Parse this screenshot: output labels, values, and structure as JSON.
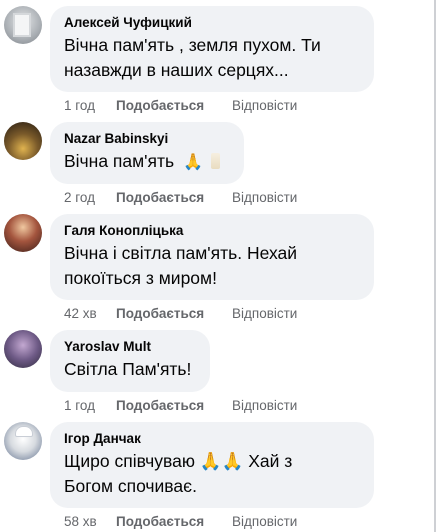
{
  "comments": [
    {
      "author": "Алексей Чуфицкий",
      "lines": [
        "Вічна пам'ять , земля пухом. Ти",
        "назавжди в наших серцях..."
      ],
      "time": "1 год",
      "like": "Подобається",
      "reply": "Відповісти",
      "avatar_colors": [
        "#cfd3d6",
        "#8d9196"
      ]
    },
    {
      "author": "Nazar Babinskyi",
      "lines": [
        "Вічна пам'ять"
      ],
      "emoji": "🙏",
      "time": "2 год",
      "like": "Подобається",
      "reply": "Відповісти",
      "avatar_colors": [
        "#3a2a1c",
        "#caa24a"
      ]
    },
    {
      "author": "Галя Коноплiцька",
      "lines": [
        "Вічна і світла пам'ять. Нехай",
        "покоїться з миром!"
      ],
      "time": "42 хв",
      "like": "Подобається",
      "reply": "Відповісти",
      "avatar_colors": [
        "#5a2a22",
        "#e7b18a"
      ]
    },
    {
      "author": "Yaroslav Mult",
      "lines": [
        "Світла Пам'ять!"
      ],
      "time": "1 год",
      "like": "Подобається",
      "reply": "Відповісти",
      "avatar_colors": [
        "#5b4a6e",
        "#b99cc7"
      ]
    },
    {
      "author": "Ігор Данчак",
      "lines": [
        "Щиро співчуваю 🙏🙏 Хай з",
        "Богом спочиває."
      ],
      "time": "58 хв",
      "like": "Подобається",
      "reply": "Відповісти",
      "avatar_colors": [
        "#e3e6ea",
        "#6d7f9c"
      ]
    }
  ]
}
